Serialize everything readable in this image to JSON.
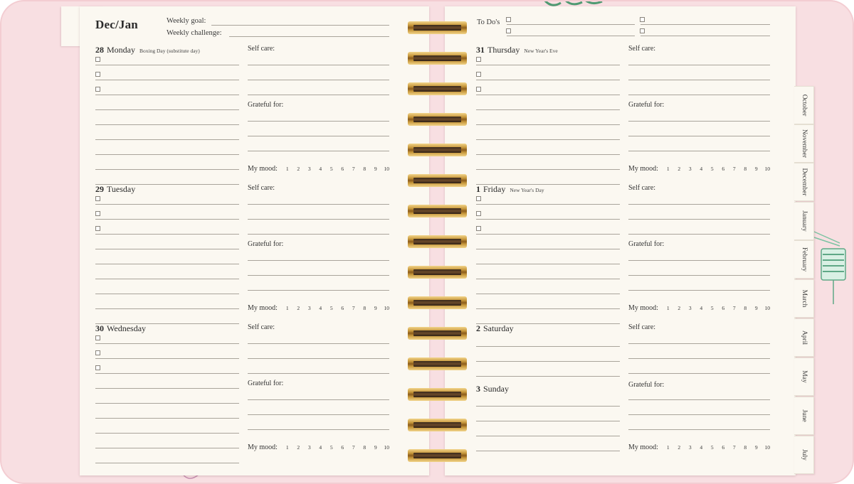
{
  "header": {
    "title": "Dec/Jan",
    "weekly_goal_label": "Weekly goal:",
    "weekly_challenge_label": "Weekly challenge:",
    "todos_label": "To Do's"
  },
  "labels": {
    "self_care": "Self care:",
    "grateful_for": "Grateful for:",
    "my_mood": "My mood:"
  },
  "mood_scale": [
    "1",
    "2",
    "3",
    "4",
    "5",
    "6",
    "7",
    "8",
    "9",
    "10"
  ],
  "days": {
    "mon": {
      "num": "28",
      "name": "Monday",
      "holiday": "Boxing Day (substitute day)"
    },
    "tue": {
      "num": "29",
      "name": "Tuesday",
      "holiday": ""
    },
    "wed": {
      "num": "30",
      "name": "Wednesday",
      "holiday": ""
    },
    "thu": {
      "num": "31",
      "name": "Thursday",
      "holiday": "New Year's Eve"
    },
    "fri": {
      "num": "1",
      "name": "Friday",
      "holiday": "New Year's Day"
    },
    "sat": {
      "num": "2",
      "name": "Saturday",
      "holiday": ""
    },
    "sun": {
      "num": "3",
      "name": "Sunday",
      "holiday": ""
    }
  },
  "month_tabs": [
    "October",
    "November",
    "December",
    "January",
    "February",
    "March",
    "April",
    "May",
    "June",
    "July"
  ],
  "colors": {
    "cover": "#f8dfe2",
    "page": "#fbf8f1",
    "ring": "#c99a3e",
    "rule": "#a9a49b"
  }
}
